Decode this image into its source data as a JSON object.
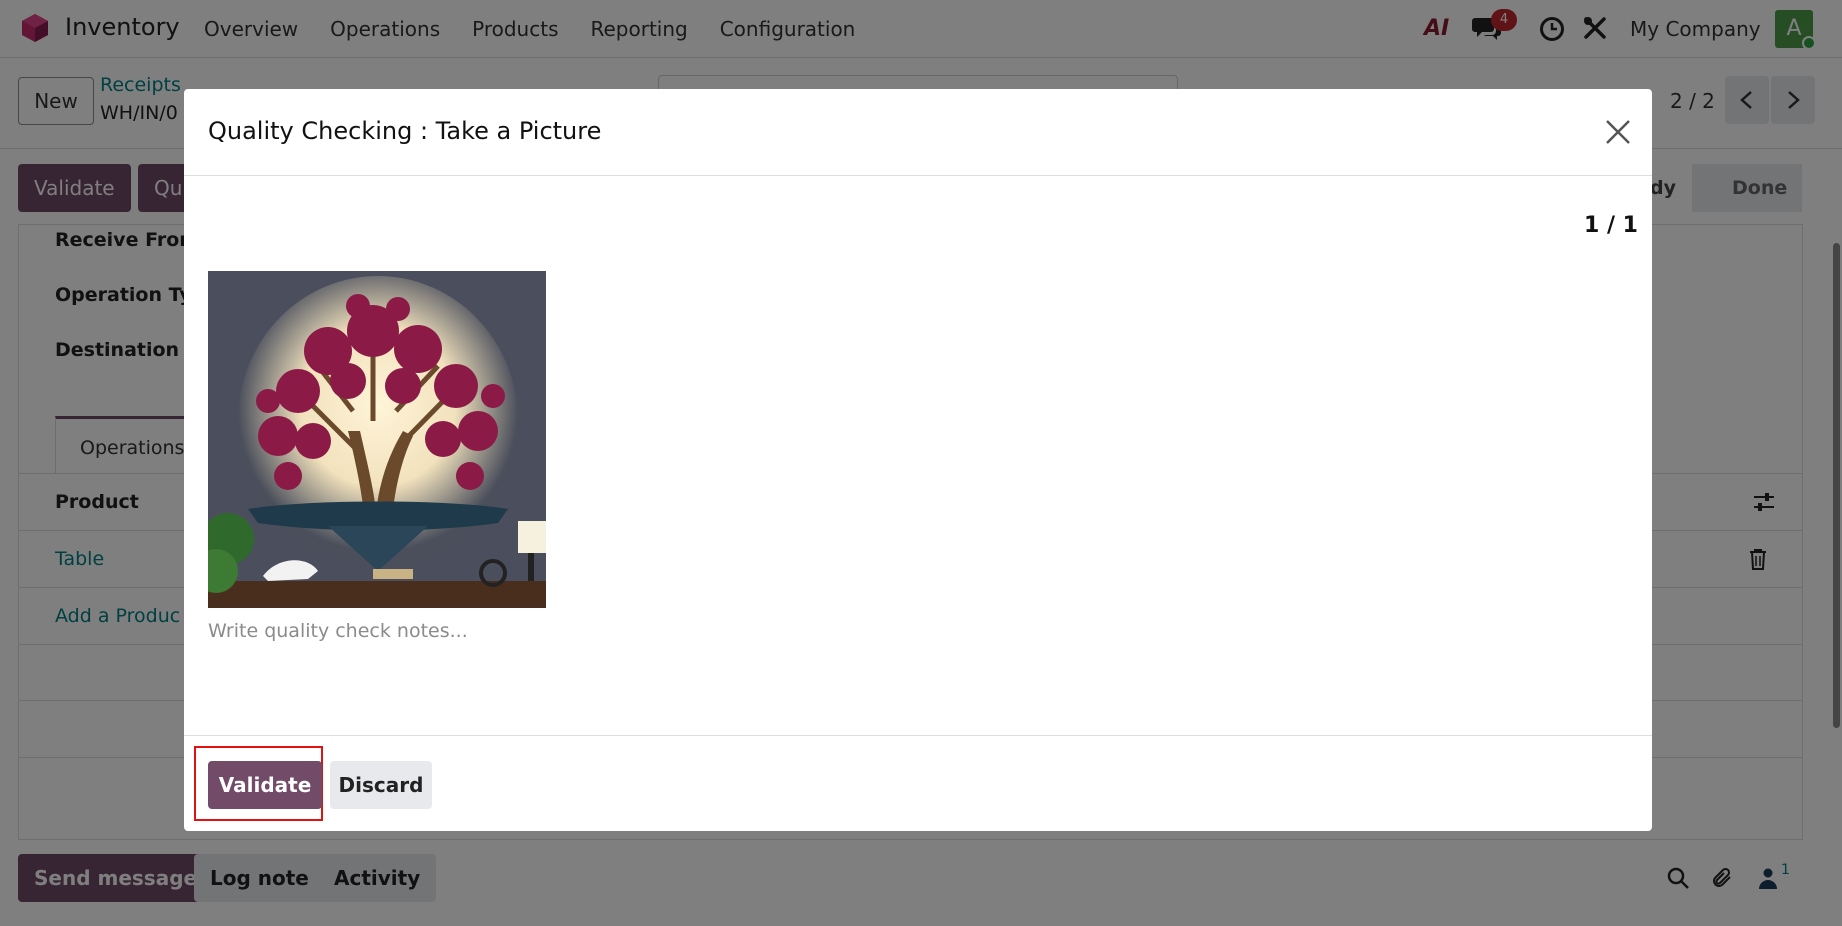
{
  "navbar": {
    "app_name": "Inventory",
    "menu": [
      "Overview",
      "Operations",
      "Products",
      "Reporting",
      "Configuration"
    ],
    "ai_label": "AI",
    "message_count": "4",
    "company": "My Company",
    "avatar_initial": "A"
  },
  "control_panel": {
    "new_label": "New",
    "breadcrumb_parent": "Receipts",
    "breadcrumb_current": "WH/IN/0",
    "pager": "2 / 2"
  },
  "form": {
    "validate_label": "Validate",
    "quality_label": "Qu",
    "status_ready": "dy",
    "status_done": "Done",
    "receive_from_label": "Receive From",
    "operation_type_label": "Operation Ty",
    "destination_label": "Destination L",
    "tab_operations": "Operations",
    "product_header": "Product",
    "product_row": "Table",
    "add_product": "Add a Produc"
  },
  "chatter": {
    "send_message": "Send message",
    "log_note": "Log note",
    "activity": "Activity",
    "follower_count": "1"
  },
  "modal": {
    "title": "Quality Checking : Take a Picture",
    "counter": "1 / 1",
    "notes_placeholder": "Write quality check notes...",
    "validate_label": "Validate",
    "discard_label": "Discard"
  },
  "colors": {
    "primary": "#714b67",
    "link": "#017e84",
    "highlight": "#e31212"
  }
}
